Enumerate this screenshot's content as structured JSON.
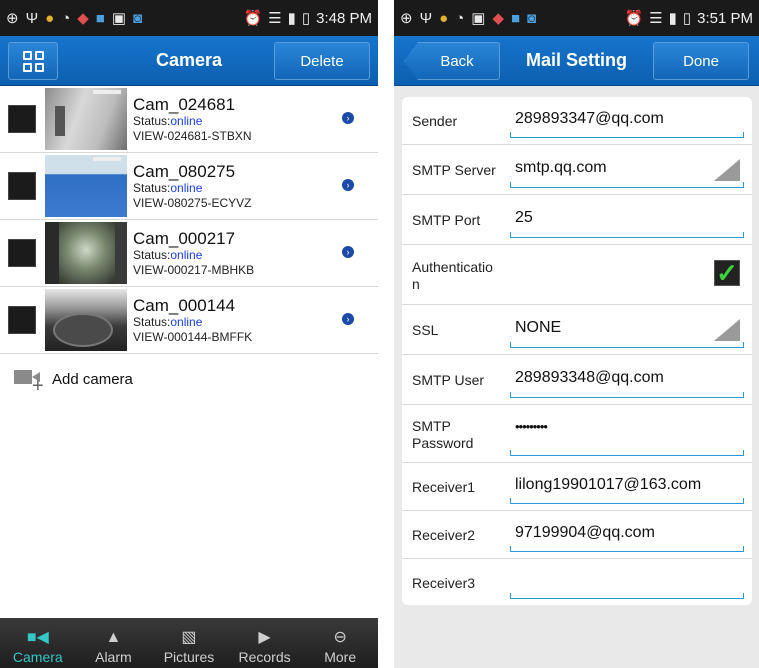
{
  "left": {
    "status_bar": {
      "time": "3:48 PM"
    },
    "header": {
      "title": "Camera",
      "delete_label": "Delete"
    },
    "cameras": [
      {
        "name": "Cam_024681",
        "status_label": "Status:",
        "status": "online",
        "id": "VIEW-024681-STBXN"
      },
      {
        "name": "Cam_080275",
        "status_label": "Status:",
        "status": "online",
        "id": "VIEW-080275-ECYVZ"
      },
      {
        "name": "Cam_000217",
        "status_label": "Status:",
        "status": "online",
        "id": "VIEW-000217-MBHKB"
      },
      {
        "name": "Cam_000144",
        "status_label": "Status:",
        "status": "online",
        "id": "VIEW-000144-BMFFK"
      }
    ],
    "add_camera_label": "Add camera",
    "tabs": [
      {
        "label": "Camera",
        "icon": "camera-icon"
      },
      {
        "label": "Alarm",
        "icon": "bell-icon"
      },
      {
        "label": "Pictures",
        "icon": "picture-icon"
      },
      {
        "label": "Records",
        "icon": "record-icon"
      },
      {
        "label": "More",
        "icon": "more-icon"
      }
    ],
    "active_tab": "Camera"
  },
  "right": {
    "status_bar": {
      "time": "3:51 PM"
    },
    "header": {
      "title": "Mail Setting",
      "back_label": "Back",
      "done_label": "Done"
    },
    "fields": {
      "sender": {
        "label": "Sender",
        "value": "289893347@qq.com"
      },
      "smtp_server": {
        "label": "SMTP Server",
        "value": "smtp.qq.com"
      },
      "smtp_port": {
        "label": "SMTP Port",
        "value": "25"
      },
      "authentication": {
        "label_line1": "Authenticatio",
        "label_line2": "n",
        "checked": true
      },
      "ssl": {
        "label": "SSL",
        "value": "NONE"
      },
      "smtp_user": {
        "label": "SMTP User",
        "value": "289893348@qq.com"
      },
      "smtp_password": {
        "label_line1": "SMTP",
        "label_line2": "Password",
        "value": "•••••••••"
      },
      "receiver1": {
        "label": "Receiver1",
        "value": "lilong19901017@163.com"
      },
      "receiver2": {
        "label": "Receiver2",
        "value": "97199904@qq.com"
      },
      "receiver3": {
        "label": "Receiver3",
        "value": ""
      }
    }
  },
  "colors": {
    "header_blue": "#1675cc",
    "status_online": "#1a3de0",
    "active_tab": "#35c6c6",
    "field_underline": "#2a9bd6",
    "check_green": "#3ad43a"
  }
}
